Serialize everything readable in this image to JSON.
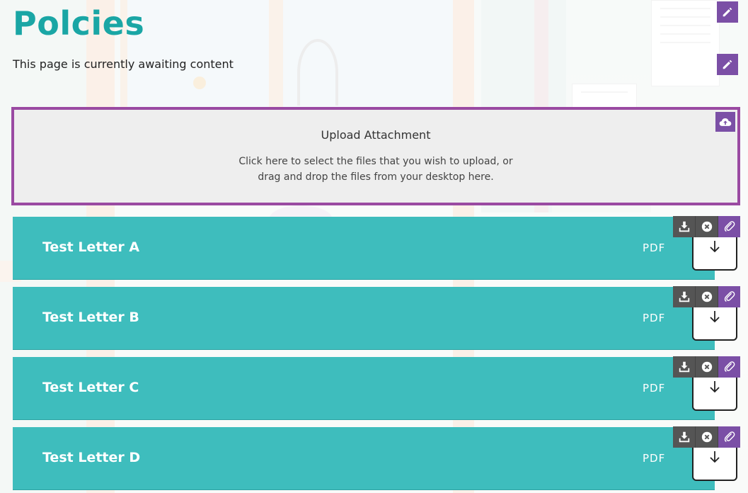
{
  "page": {
    "title": "Polcies",
    "intro": "This page is currently awaiting content"
  },
  "upload": {
    "title": "Upload Attachment",
    "description": "Click here to select the files that you wish to upload, or drag and drop the files from your desktop here."
  },
  "attachments": [
    {
      "name": "Test Letter A",
      "type": "PDF"
    },
    {
      "name": "Test Letter B",
      "type": "PDF"
    },
    {
      "name": "Test Letter C",
      "type": "PDF"
    },
    {
      "name": "Test Letter D",
      "type": "PDF"
    }
  ],
  "icons": {
    "edit": "pencil-icon",
    "upload": "cloud-upload-icon",
    "download": "download-icon",
    "remove": "close-circle-icon",
    "attach": "paperclip-icon",
    "arrow": "arrow-down-icon"
  },
  "colors": {
    "title": "#1aa6a5",
    "attachment_bar": "#3ebdbd",
    "accent_purple": "#7b4fa6",
    "upload_border": "#9a4aa2",
    "tool_dark": "#555555"
  }
}
